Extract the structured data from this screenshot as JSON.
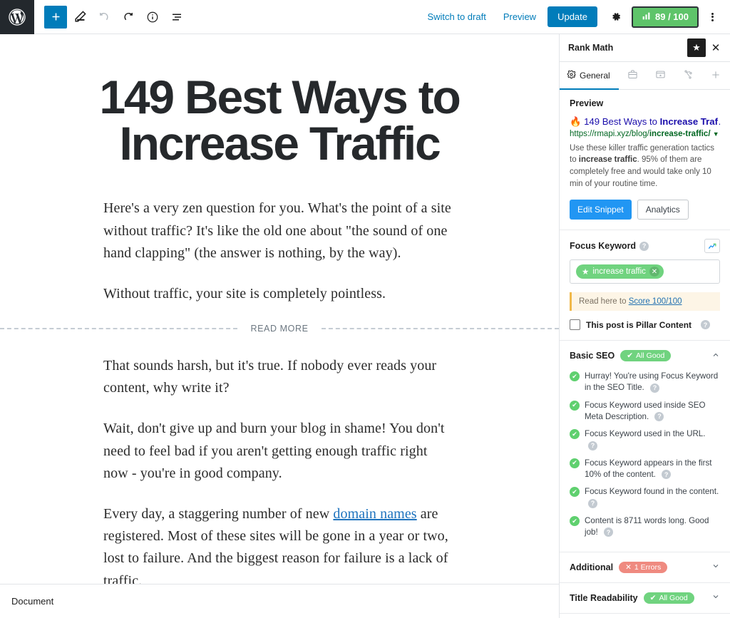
{
  "topbar": {
    "logo_icon": "wordpress-logo-icon",
    "add_block_icon": "plus-icon",
    "edit_tool_icon": "pencil-icon",
    "undo_icon": "undo-arrow-icon",
    "redo_icon": "redo-arrow-icon",
    "info_icon": "info-circle-icon",
    "list_view_icon": "list-view-icon",
    "switch_to_draft": "Switch to draft",
    "preview": "Preview",
    "update": "Update",
    "settings_icon": "gear-icon",
    "seo_score": "89 / 100",
    "seo_score_icon": "bar-chart-icon",
    "seo_score_color": "#5ec46a",
    "more_icon": "kebab-menu-icon"
  },
  "editor": {
    "title": "149 Best Ways to Increase Traffic",
    "paragraphs_before": [
      "Here's a very zen question for you. What's the point of a site without traffic? It's like the old one about \"the sound of one hand clapping\" (the answer is nothing, by the way).",
      "Without traffic, your site is completely pointless."
    ],
    "read_more_label": "READ MORE",
    "paragraphs_after": [
      "That sounds harsh, but it's true. If nobody ever reads your content, why write it?",
      "Wait, don't give up and burn your blog in shame! You don't need to feel bad if you aren't getting enough traffic right now - you're in good company."
    ],
    "last_paragraph": {
      "before_link": "Every day, a staggering number of new ",
      "link_text": "domain names",
      "after_link": " are registered. Most of these sites will be gone in a year or two, lost to failure. And the biggest reason for failure is a lack of traffic."
    }
  },
  "bottombar": {
    "document_label": "Document"
  },
  "sidebar": {
    "title": "Rank Math",
    "star_icon": "star-icon",
    "close_icon": "close-icon",
    "tabs": [
      {
        "label": "General",
        "icon": "gear-icon",
        "active": true
      },
      {
        "label": "",
        "icon": "briefcase-icon",
        "active": false
      },
      {
        "label": "",
        "icon": "rich-snippet-icon",
        "active": false
      },
      {
        "label": "",
        "icon": "social-share-icon",
        "active": false
      },
      {
        "label": "",
        "icon": "plus-icon",
        "active": false
      }
    ],
    "preview": {
      "heading": "Preview",
      "fire_icon": "fire-emoji-icon",
      "title_normal": "149 Best Ways to ",
      "title_bold": "Increase Traf",
      "title_ellipsis": "…",
      "url_normal": "https://rmapi.xyz/blog/",
      "url_bold": "increase-traffic/",
      "url_caret_icon": "chevron-down-icon",
      "desc_part1": "Use these killer traffic generation tactics to ",
      "desc_bold": "increase traffic",
      "desc_part2": ". 95% of them are completely free and would take only 10 min of your routine time.",
      "edit_snippet": "Edit Snippet",
      "analytics": "Analytics"
    },
    "focus_keyword": {
      "label": "Focus Keyword",
      "help_icon": "help-icon",
      "trend_icon": "trend-chart-icon",
      "chip_star_icon": "star-icon",
      "chip_text": "increase traffic",
      "chip_remove_icon": "close-icon",
      "chip_color": "#70d37f"
    },
    "notice": {
      "text_before": "Read here to ",
      "link_text": "Score 100/100"
    },
    "pillar": {
      "label": "This post is Pillar Content",
      "help_icon": "help-icon",
      "checked": false
    },
    "basic_seo": {
      "title": "Basic SEO",
      "badge": "All Good",
      "badge_icon": "checkmark-icon",
      "badge_color": "#70d37f",
      "chevron_icon": "chevron-up-icon",
      "items": [
        "Hurray! You're using Focus Keyword in the SEO Title.",
        "Focus Keyword used inside SEO Meta Description.",
        "Focus Keyword used in the URL.",
        "Focus Keyword appears in the first 10% of the content.",
        "Focus Keyword found in the content.",
        "Content is 8711 words long. Good job!"
      ]
    },
    "additional": {
      "title": "Additional",
      "badge": "1 Errors",
      "badge_icon": "cross-icon",
      "badge_color": "#ef8a80",
      "chevron_icon": "chevron-down-icon"
    },
    "title_readability": {
      "title": "Title Readability",
      "badge": "All Good",
      "badge_icon": "checkmark-icon",
      "badge_color": "#70d37f",
      "chevron_icon": "chevron-down-icon"
    }
  }
}
